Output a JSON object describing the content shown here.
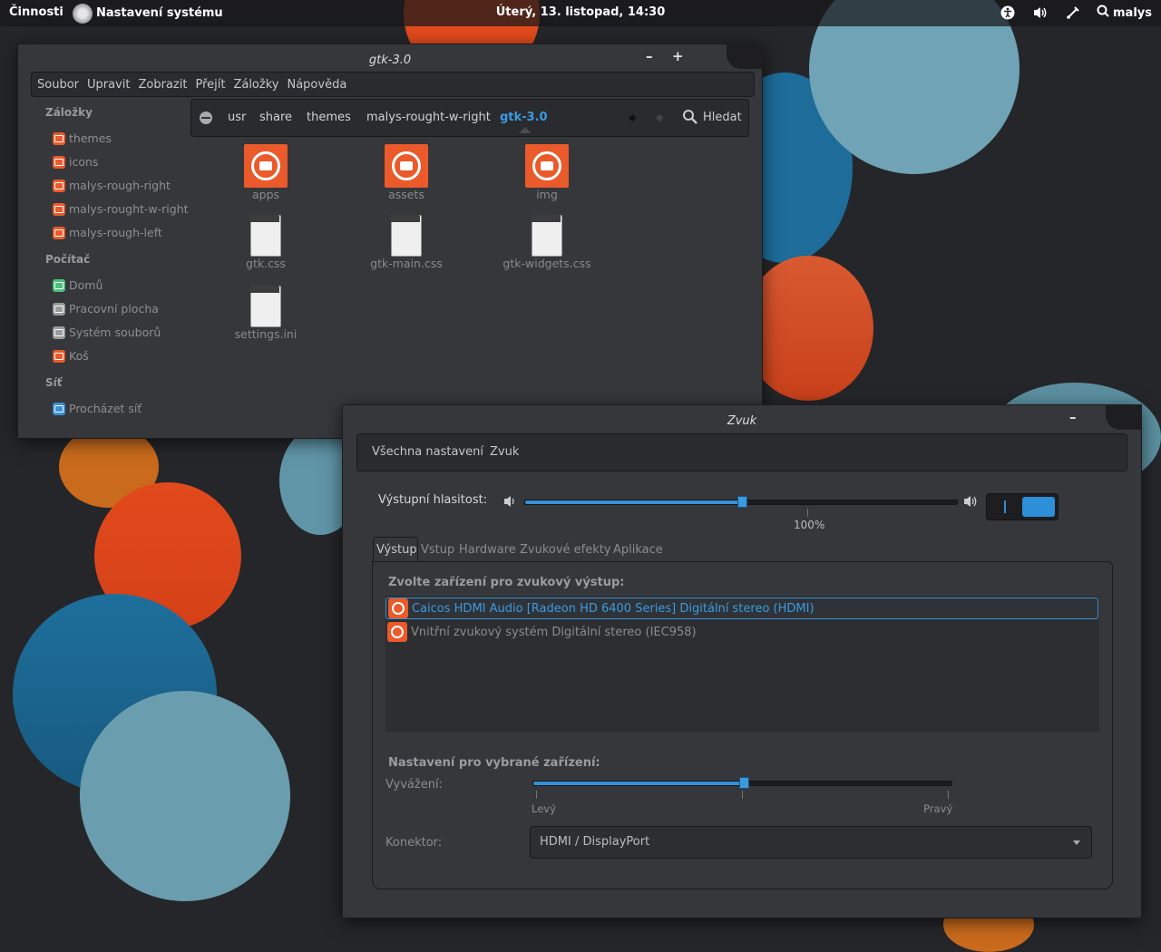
{
  "topbar": {
    "activities": "Činnosti",
    "app_title": "Nastavení systému",
    "clock": "Úterý, 13. listopad, 14:30",
    "user": "malys"
  },
  "file_manager": {
    "title": "gtk-3.0",
    "menu": [
      "Soubor",
      "Upravit",
      "Zobrazit",
      "Přejít",
      "Záložky",
      "Nápověda"
    ],
    "sidebar": {
      "bookmarks_header": "Záložky",
      "bookmarks": [
        "themes",
        "icons",
        "malys-rough-right",
        "malys-rought-w-right",
        "malys-rough-left"
      ],
      "computer_header": "Počítač",
      "computer": [
        "Domů",
        "Pracovní plocha",
        "Systém souborů",
        "Koš"
      ],
      "network_header": "Síť",
      "network": [
        "Procházet síť"
      ]
    },
    "path": [
      "usr",
      "share",
      "themes",
      "malys-rought-w-right",
      "gtk-3.0"
    ],
    "search_label": "Hledat",
    "files": [
      {
        "name": "apps",
        "kind": "folder"
      },
      {
        "name": "assets",
        "kind": "folder"
      },
      {
        "name": "img",
        "kind": "folder"
      },
      {
        "name": "gtk.css",
        "kind": "file"
      },
      {
        "name": "gtk-main.css",
        "kind": "file"
      },
      {
        "name": "gtk-widgets.css",
        "kind": "file"
      },
      {
        "name": "settings.ini",
        "kind": "file"
      }
    ]
  },
  "sound": {
    "title": "Zvuk",
    "breadcrumb": [
      "Všechna nastavení",
      "Zvuk"
    ],
    "output_volume_label": "Výstupní hlasitost:",
    "volume_percent_label": "100%",
    "volume_level": 0.5,
    "tabs": [
      "Výstup",
      "Vstup",
      "Hardware",
      "Zvukové efekty",
      "Aplikace"
    ],
    "device_header": "Zvolte zařízení pro zvukový výstup:",
    "devices": [
      "Caicos HDMI Audio [Radeon HD 6400 Series] Digitální stereo (HDMI)",
      "Vnitřní zvukový systém Digitální stereo (IEC958)"
    ],
    "settings_header": "Nastavení pro vybrané zařízení:",
    "balance_label": "Vyvážení:",
    "balance_left": "Levý",
    "balance_right": "Pravý",
    "balance_level": 0.5,
    "connector_label": "Konektor:",
    "connector_value": "HDMI / DisplayPort"
  },
  "colors": {
    "accent_blue": "#3a9ae0",
    "accent_orange": "#ea5a2a",
    "window_bg": "#36373a"
  }
}
